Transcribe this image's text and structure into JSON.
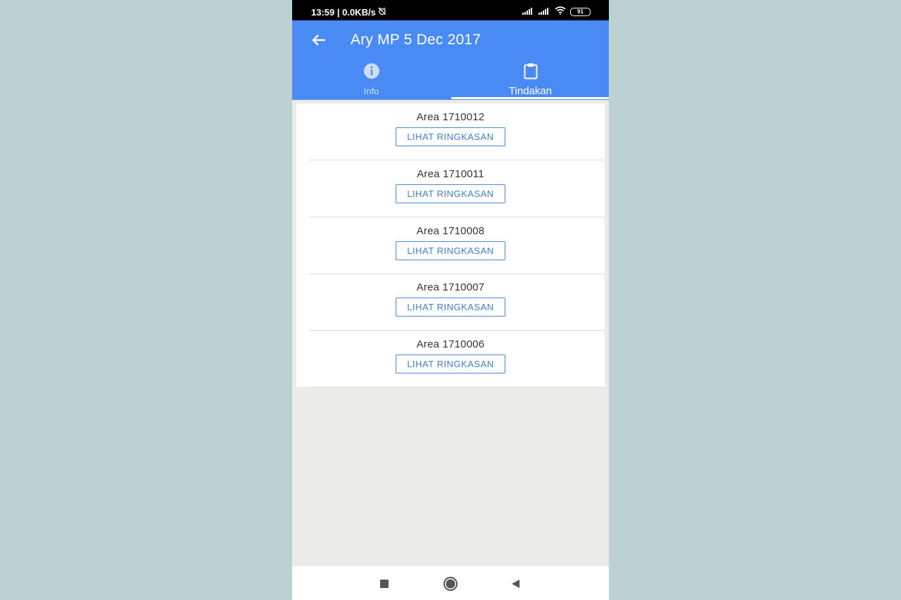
{
  "status_bar": {
    "time_speed": "13:59 | 0.0KB/s",
    "alarm_icon": "alarm-off-icon",
    "signal1_icon": "signal-icon",
    "signal2_icon": "signal-icon",
    "wifi_icon": "wifi-icon",
    "battery": "91"
  },
  "app_bar": {
    "back_icon": "arrow-left-icon",
    "title": "Ary MP 5 Dec 2017",
    "background": "#4a8af4"
  },
  "tabs": [
    {
      "label": "Info",
      "icon": "info-icon",
      "selected": false
    },
    {
      "label": "Tindakan",
      "icon": "clipboard-icon",
      "selected": true
    }
  ],
  "areas": [
    {
      "label": "Area 1710012",
      "button": "LIHAT RINGKASAN"
    },
    {
      "label": "Area 1710011",
      "button": "LIHAT RINGKASAN"
    },
    {
      "label": "Area 1710008",
      "button": "LIHAT RINGKASAN"
    },
    {
      "label": "Area 1710007",
      "button": "LIHAT RINGKASAN"
    },
    {
      "label": "Area 1710006",
      "button": "LIHAT RINGKASAN"
    }
  ],
  "nav_bar": {
    "recents_icon": "square-icon",
    "home_icon": "circle-icon",
    "back_icon": "triangle-back-icon"
  },
  "colors": {
    "accent": "#4a8af4",
    "button_text": "#3f7fd6",
    "page_background": "#ebebea"
  }
}
